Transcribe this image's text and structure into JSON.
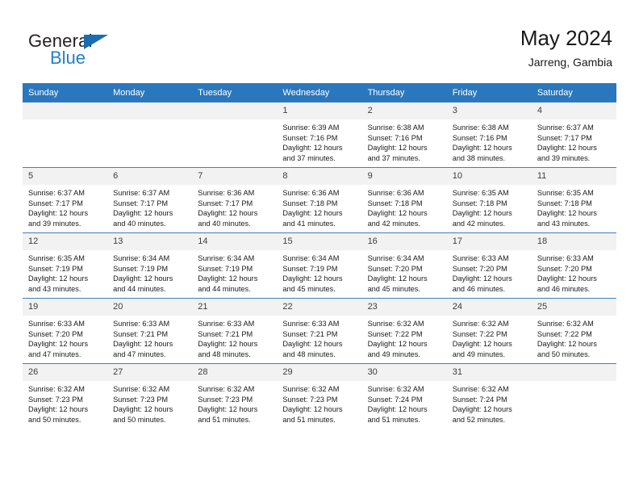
{
  "brand": {
    "name_part1": "General",
    "name_part2": "Blue",
    "triangle_color": "#1b6cb0",
    "blue_color": "#2181c8"
  },
  "header": {
    "title": "May 2024",
    "subtitle": "Jarreng, Gambia"
  },
  "theme": {
    "header_bg": "#2b77bd",
    "header_text": "#ffffff",
    "daynum_bg": "#f2f2f2",
    "grid_line": "#3a7fc1"
  },
  "weekdays": [
    "Sunday",
    "Monday",
    "Tuesday",
    "Wednesday",
    "Thursday",
    "Friday",
    "Saturday"
  ],
  "labels": {
    "sunrise_prefix": "Sunrise:",
    "sunset_prefix": "Sunset:",
    "daylight_prefix": "Daylight:"
  },
  "weeks": [
    [
      {
        "blank": true
      },
      {
        "blank": true
      },
      {
        "blank": true
      },
      {
        "day": "1",
        "sunrise": "Sunrise: 6:39 AM",
        "sunset": "Sunset: 7:16 PM",
        "daylight1": "Daylight: 12 hours",
        "daylight2": "and 37 minutes."
      },
      {
        "day": "2",
        "sunrise": "Sunrise: 6:38 AM",
        "sunset": "Sunset: 7:16 PM",
        "daylight1": "Daylight: 12 hours",
        "daylight2": "and 37 minutes."
      },
      {
        "day": "3",
        "sunrise": "Sunrise: 6:38 AM",
        "sunset": "Sunset: 7:16 PM",
        "daylight1": "Daylight: 12 hours",
        "daylight2": "and 38 minutes."
      },
      {
        "day": "4",
        "sunrise": "Sunrise: 6:37 AM",
        "sunset": "Sunset: 7:17 PM",
        "daylight1": "Daylight: 12 hours",
        "daylight2": "and 39 minutes."
      }
    ],
    [
      {
        "day": "5",
        "sunrise": "Sunrise: 6:37 AM",
        "sunset": "Sunset: 7:17 PM",
        "daylight1": "Daylight: 12 hours",
        "daylight2": "and 39 minutes."
      },
      {
        "day": "6",
        "sunrise": "Sunrise: 6:37 AM",
        "sunset": "Sunset: 7:17 PM",
        "daylight1": "Daylight: 12 hours",
        "daylight2": "and 40 minutes."
      },
      {
        "day": "7",
        "sunrise": "Sunrise: 6:36 AM",
        "sunset": "Sunset: 7:17 PM",
        "daylight1": "Daylight: 12 hours",
        "daylight2": "and 40 minutes."
      },
      {
        "day": "8",
        "sunrise": "Sunrise: 6:36 AM",
        "sunset": "Sunset: 7:18 PM",
        "daylight1": "Daylight: 12 hours",
        "daylight2": "and 41 minutes."
      },
      {
        "day": "9",
        "sunrise": "Sunrise: 6:36 AM",
        "sunset": "Sunset: 7:18 PM",
        "daylight1": "Daylight: 12 hours",
        "daylight2": "and 42 minutes."
      },
      {
        "day": "10",
        "sunrise": "Sunrise: 6:35 AM",
        "sunset": "Sunset: 7:18 PM",
        "daylight1": "Daylight: 12 hours",
        "daylight2": "and 42 minutes."
      },
      {
        "day": "11",
        "sunrise": "Sunrise: 6:35 AM",
        "sunset": "Sunset: 7:18 PM",
        "daylight1": "Daylight: 12 hours",
        "daylight2": "and 43 minutes."
      }
    ],
    [
      {
        "day": "12",
        "sunrise": "Sunrise: 6:35 AM",
        "sunset": "Sunset: 7:19 PM",
        "daylight1": "Daylight: 12 hours",
        "daylight2": "and 43 minutes."
      },
      {
        "day": "13",
        "sunrise": "Sunrise: 6:34 AM",
        "sunset": "Sunset: 7:19 PM",
        "daylight1": "Daylight: 12 hours",
        "daylight2": "and 44 minutes."
      },
      {
        "day": "14",
        "sunrise": "Sunrise: 6:34 AM",
        "sunset": "Sunset: 7:19 PM",
        "daylight1": "Daylight: 12 hours",
        "daylight2": "and 44 minutes."
      },
      {
        "day": "15",
        "sunrise": "Sunrise: 6:34 AM",
        "sunset": "Sunset: 7:19 PM",
        "daylight1": "Daylight: 12 hours",
        "daylight2": "and 45 minutes."
      },
      {
        "day": "16",
        "sunrise": "Sunrise: 6:34 AM",
        "sunset": "Sunset: 7:20 PM",
        "daylight1": "Daylight: 12 hours",
        "daylight2": "and 45 minutes."
      },
      {
        "day": "17",
        "sunrise": "Sunrise: 6:33 AM",
        "sunset": "Sunset: 7:20 PM",
        "daylight1": "Daylight: 12 hours",
        "daylight2": "and 46 minutes."
      },
      {
        "day": "18",
        "sunrise": "Sunrise: 6:33 AM",
        "sunset": "Sunset: 7:20 PM",
        "daylight1": "Daylight: 12 hours",
        "daylight2": "and 46 minutes."
      }
    ],
    [
      {
        "day": "19",
        "sunrise": "Sunrise: 6:33 AM",
        "sunset": "Sunset: 7:20 PM",
        "daylight1": "Daylight: 12 hours",
        "daylight2": "and 47 minutes."
      },
      {
        "day": "20",
        "sunrise": "Sunrise: 6:33 AM",
        "sunset": "Sunset: 7:21 PM",
        "daylight1": "Daylight: 12 hours",
        "daylight2": "and 47 minutes."
      },
      {
        "day": "21",
        "sunrise": "Sunrise: 6:33 AM",
        "sunset": "Sunset: 7:21 PM",
        "daylight1": "Daylight: 12 hours",
        "daylight2": "and 48 minutes."
      },
      {
        "day": "22",
        "sunrise": "Sunrise: 6:33 AM",
        "sunset": "Sunset: 7:21 PM",
        "daylight1": "Daylight: 12 hours",
        "daylight2": "and 48 minutes."
      },
      {
        "day": "23",
        "sunrise": "Sunrise: 6:32 AM",
        "sunset": "Sunset: 7:22 PM",
        "daylight1": "Daylight: 12 hours",
        "daylight2": "and 49 minutes."
      },
      {
        "day": "24",
        "sunrise": "Sunrise: 6:32 AM",
        "sunset": "Sunset: 7:22 PM",
        "daylight1": "Daylight: 12 hours",
        "daylight2": "and 49 minutes."
      },
      {
        "day": "25",
        "sunrise": "Sunrise: 6:32 AM",
        "sunset": "Sunset: 7:22 PM",
        "daylight1": "Daylight: 12 hours",
        "daylight2": "and 50 minutes."
      }
    ],
    [
      {
        "day": "26",
        "sunrise": "Sunrise: 6:32 AM",
        "sunset": "Sunset: 7:23 PM",
        "daylight1": "Daylight: 12 hours",
        "daylight2": "and 50 minutes."
      },
      {
        "day": "27",
        "sunrise": "Sunrise: 6:32 AM",
        "sunset": "Sunset: 7:23 PM",
        "daylight1": "Daylight: 12 hours",
        "daylight2": "and 50 minutes."
      },
      {
        "day": "28",
        "sunrise": "Sunrise: 6:32 AM",
        "sunset": "Sunset: 7:23 PM",
        "daylight1": "Daylight: 12 hours",
        "daylight2": "and 51 minutes."
      },
      {
        "day": "29",
        "sunrise": "Sunrise: 6:32 AM",
        "sunset": "Sunset: 7:23 PM",
        "daylight1": "Daylight: 12 hours",
        "daylight2": "and 51 minutes."
      },
      {
        "day": "30",
        "sunrise": "Sunrise: 6:32 AM",
        "sunset": "Sunset: 7:24 PM",
        "daylight1": "Daylight: 12 hours",
        "daylight2": "and 51 minutes."
      },
      {
        "day": "31",
        "sunrise": "Sunrise: 6:32 AM",
        "sunset": "Sunset: 7:24 PM",
        "daylight1": "Daylight: 12 hours",
        "daylight2": "and 52 minutes."
      },
      {
        "blank": true
      }
    ]
  ]
}
